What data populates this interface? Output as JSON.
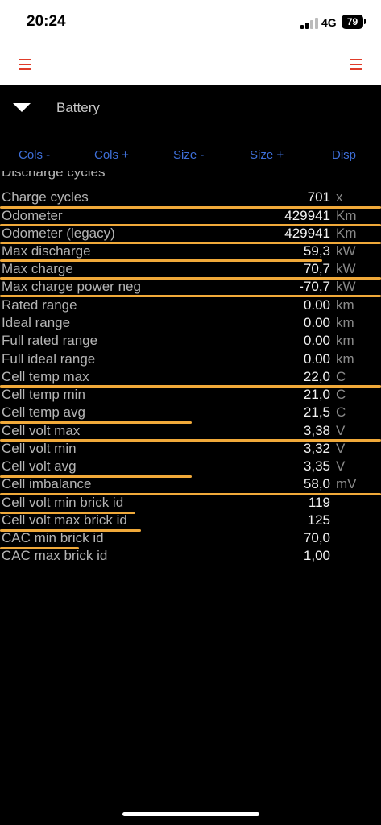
{
  "status": {
    "time": "20:24",
    "network": "4G",
    "battery": "79"
  },
  "section": {
    "title": "Battery"
  },
  "toolbar": {
    "cols_minus": "Cols -",
    "cols_plus": "Cols +",
    "size_minus": "Size -",
    "size_plus": "Size +",
    "disp": "Disp"
  },
  "rows": [
    {
      "label": "Discharge cycles",
      "value": "",
      "unit": ""
    },
    {
      "label": "Charge cycles",
      "value": "701",
      "unit": "x"
    },
    {
      "label": "Odometer",
      "value": "429941",
      "unit": "Km"
    },
    {
      "label": "Odometer (legacy)",
      "value": "429941",
      "unit": "Km"
    },
    {
      "label": "Max discharge",
      "value": "59,3",
      "unit": "kW"
    },
    {
      "label": "Max charge",
      "value": "70,7",
      "unit": "kW"
    },
    {
      "label": "Max charge power neg",
      "value": "-70,7",
      "unit": "kW"
    },
    {
      "label": "Rated range",
      "value": "0.00",
      "unit": "km"
    },
    {
      "label": "Ideal range",
      "value": "0.00",
      "unit": "km"
    },
    {
      "label": "Full rated range",
      "value": "0.00",
      "unit": "km"
    },
    {
      "label": "Full ideal range",
      "value": "0.00",
      "unit": "km"
    },
    {
      "label": "Cell temp max",
      "value": "22,0",
      "unit": "C"
    },
    {
      "label": "Cell temp min",
      "value": "21,0",
      "unit": "C"
    },
    {
      "label": "Cell temp avg",
      "value": "21,5",
      "unit": "C"
    },
    {
      "label": "Cell volt max",
      "value": "3,38",
      "unit": "V"
    },
    {
      "label": "Cell volt min",
      "value": "3,32",
      "unit": "V"
    },
    {
      "label": "Cell volt avg",
      "value": "3,35",
      "unit": "V"
    },
    {
      "label": "Cell imbalance",
      "value": "58,0",
      "unit": "mV"
    },
    {
      "label": "Cell volt min brick id",
      "value": "119",
      "unit": ""
    },
    {
      "label": "Cell volt max brick id",
      "value": "125",
      "unit": ""
    },
    {
      "label": "CAC min brick id",
      "value": "70,0",
      "unit": ""
    },
    {
      "label": "CAC max brick id",
      "value": "1,00",
      "unit": ""
    }
  ],
  "colors": {
    "accent_link": "#3e6fd8",
    "menu_icon": "#e03c2a",
    "annotation_underline": "#f0a93a"
  }
}
